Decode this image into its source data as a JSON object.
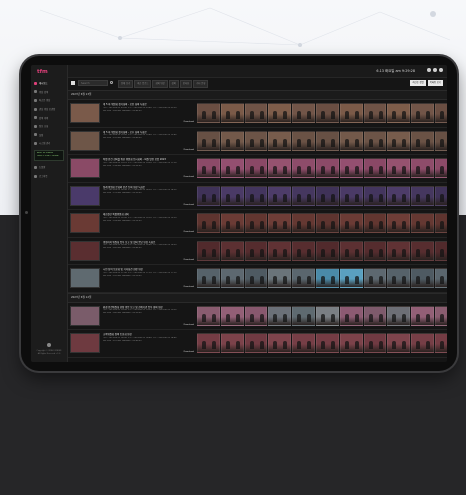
{
  "app": {
    "logo_text": "tfm",
    "accent": "#e0407a",
    "status_text": "6.13 화요일 am 9:29:28",
    "icons": [
      "cloud-icon",
      "user-icon",
      "logout-icon"
    ]
  },
  "sidebar": {
    "items": [
      {
        "label": "대시보드",
        "active": true
      },
      {
        "label": "영상 검색",
        "active": false
      },
      {
        "label": "최근본 영상",
        "active": false
      },
      {
        "label": "관심 영상 보관함",
        "active": false
      },
      {
        "label": "검색 이력",
        "active": false
      },
      {
        "label": "정보 조회",
        "active": false
      },
      {
        "label": "설정",
        "active": false
      },
      {
        "label": "시스템 관리",
        "active": false
      },
      {
        "label": "도움말",
        "active": false
      },
      {
        "label": "로그아웃",
        "active": false
      }
    ],
    "box_lines": [
      "Total: 35 Videos",
      "Used: 1.2GB / 100GB"
    ],
    "footer_lines": [
      "Copyright © VIDEO FINDER",
      "All Rights Reserved. v1.0"
    ]
  },
  "toolbar": {
    "search_placeholder": "Search",
    "filters": [
      "전체 보기",
      "최근 업로드",
      "회의 영상",
      "강의",
      "인터뷰",
      "기타 분류"
    ],
    "sort": [
      "최신순 정렬",
      "목록형 보기"
    ]
  },
  "sections": [
    {
      "title": "2023년 6월 13일",
      "rows": [
        {
          "title": "제 5 차 위원회 정기회의 - 오전 회의 녹화본",
          "line1": "게시 : 2023-06-13 09:00, 분량 : 2023-06-13 09:45, 시간 : 2023-06-13 09:50",
          "line2": "File Size : 245 MB, Duration : 00:45:00",
          "download": "Download",
          "thumb": "#7a5a4a",
          "frames": [
            "#6a4e42",
            "#7b5a48",
            "#6f5346",
            "#7e5d4a",
            "#725548",
            "#6a4e42",
            "#7b5a48",
            "#6f5346",
            "#7e5d4a",
            "#725548",
            "#6a4e42"
          ]
        },
        {
          "title": "제 5 차 위원회 정기회의 - 오후 회의 녹화본",
          "line1": "게시 : 2023-06-13 13:00, 분량 : 2023-06-13 13:40, 시간 : 2023-06-13 13:45",
          "line2": "File Size : 232 MB, Duration : 00:40:00",
          "download": "Download",
          "thumb": "#6e5648",
          "frames": [
            "#675044",
            "#73594a",
            "#6c5447",
            "#775c4c",
            "#6a5245",
            "#675044",
            "#73594a",
            "#6c5447",
            "#775c4c",
            "#6a5245",
            "#675044"
          ]
        },
        {
          "title": "특별 안건 심의를 위한 위원회 임시회의 - 의원 발언 모음 2023",
          "line1": "게시 : 2023-06-13 10:15, 분량 : 2023-06-13 10:50, 시간 : 2023-06-13 11:00",
          "line2": "File Size : 198 MB, Duration : 00:35:00",
          "download": "Download",
          "thumb": "#8a4a66",
          "frames": [
            "#8c4a68",
            "#944f70",
            "#8a4866",
            "#96526f",
            "#8e4c6a",
            "#8c4a68",
            "#944f70",
            "#8a4866",
            "#96526f",
            "#8e4c6a",
            "#8c4a68"
          ]
        },
        {
          "title": "정례 위원회 본회의 안건 토의 영상 녹화본",
          "line1": "게시 : 2023-06-13 14:00, 분량 : 2023-06-13 14:30, 시간 : 2023-06-13 14:35",
          "line2": "File Size : 176 MB, Duration : 00:30:00",
          "download": "Download",
          "thumb": "#4a3a6a",
          "frames": [
            "#3f3258",
            "#4a3a66",
            "#43355e",
            "#4d3c69",
            "#45375f",
            "#3f3258",
            "#4a3a66",
            "#43355e",
            "#4d3c69",
            "#45375f",
            "#3f3258"
          ]
        },
        {
          "title": "예산결산 특별위원회 회의",
          "line1": "게시 : 2023-06-13 15:00, 분량 : 2023-06-13 15:25, 시간 : 2023-06-13 15:30",
          "line2": "File Size : 154 MB, Duration : 00:25:00",
          "download": "Download",
          "thumb": "#6a3a34",
          "frames": [
            "#5e342f",
            "#6b3b35",
            "#623630",
            "#6e3d37",
            "#653832",
            "#5e342f",
            "#6b3b35",
            "#623630",
            "#6e3d37",
            "#653832",
            "#5e342f"
          ]
        },
        {
          "title": "행정자치 위원회 업무 보고 및 질의 응답 영상 녹화본",
          "line1": "게시 : 2023-06-13 16:00, 분량 : 2023-06-13 16:45, 시간 : 2023-06-13 16:50",
          "line2": "File Size : 260 MB, Duration : 00:45:00",
          "download": "Download",
          "thumb": "#5a2e30",
          "frames": [
            "#512a2c",
            "#5c3032",
            "#552c2e",
            "#603234",
            "#572d2f",
            "#512a2c",
            "#5c3032",
            "#552c2e",
            "#603234",
            "#572d2f",
            "#512a2c"
          ]
        },
        {
          "title": "시민 참여 토론회 및 기자회견 현장 영상",
          "line1": "게시 : 2023-06-13 17:00, 분량 : 2023-06-13 17:20, 시간 : 2023-06-13 17:25",
          "line2": "File Size : 120 MB, Duration : 00:20:00",
          "download": "Download",
          "thumb": "#5f6a70",
          "frames": [
            "#56626a",
            "#5d6870",
            "#4e5a62",
            "#6a747a",
            "#5a666e",
            "#4a8aa8",
            "#5aa0c0",
            "#5d6870",
            "#56626a",
            "#4e5a62",
            "#5a666e"
          ]
        }
      ]
    },
    {
      "title": "2023년 6월 12일",
      "rows": [
        {
          "title": "환경 안전위원회 현장 방문 보고 및 관계기관 업무 협의 영상",
          "line1": "게시 : 2023-06-12 10:00, 분량 : 2023-06-12 10:30, 시간 : 2023-06-12 10:35",
          "line2": "File Size : 180 MB, Duration : 00:30:00",
          "download": "Download",
          "thumb": "#7a5c6a",
          "frames": [
            "#8a5c70",
            "#935f76",
            "#88586e",
            "#6b7078",
            "#5e6a70",
            "#7a7f84",
            "#8c5a72",
            "#7e5a6c",
            "#6d6f76",
            "#935f76",
            "#8a5c70"
          ]
        },
        {
          "title": "교육위원회 정책 토론회 영상",
          "line1": "게시 : 2023-06-12 14:00, 분량 : 2023-06-12 14:40, 시간 : 2023-06-12 14:45",
          "line2": "File Size : 210 MB, Duration : 00:40:00",
          "download": "Download",
          "thumb": "#6e3a40",
          "frames": [
            "#743c44",
            "#7c424a",
            "#703a42",
            "#7e444c",
            "#763e46",
            "#743c44",
            "#7c424a",
            "#703a42",
            "#7e444c",
            "#763e46",
            "#743c44"
          ]
        }
      ]
    }
  ]
}
